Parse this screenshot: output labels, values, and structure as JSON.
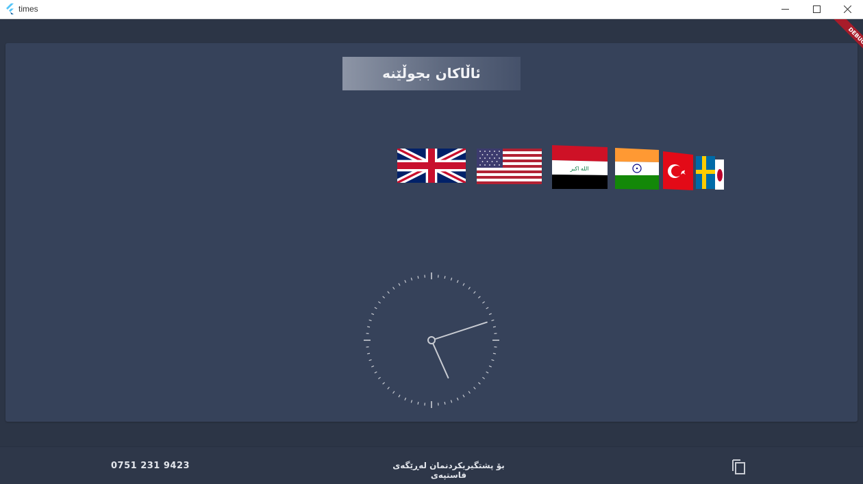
{
  "window": {
    "title": "times",
    "controls": [
      "minimize-icon",
      "maximize-icon",
      "close-icon"
    ]
  },
  "debug_banner": "DEBUG",
  "main": {
    "title": "ئاڵاکان بجوڵێنە",
    "flags": [
      "united-kingdom",
      "united-states",
      "iraq",
      "india",
      "turkey",
      "sweden",
      "japan"
    ],
    "flag_inscriptions": {
      "iraq": "الله اكبر"
    }
  },
  "clock": {
    "hour": 5,
    "minute": 12
  },
  "footer": {
    "phone": "0751 231 9423",
    "support_text": "بۆ پشتگیریکردنمان لەڕێگەی فاستپەی",
    "copy_icon": "copy-icon"
  },
  "colors": {
    "background": "#2c3546",
    "panel": "#36425a",
    "clock_stroke": "#c9ccd3",
    "footer": "#2e3749"
  }
}
